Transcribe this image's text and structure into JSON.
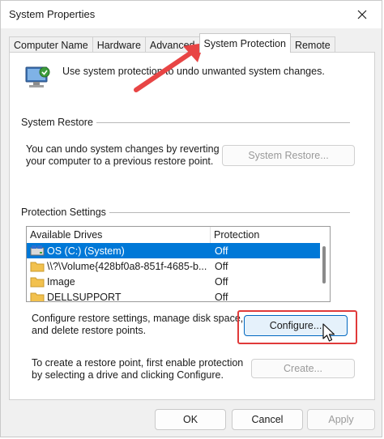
{
  "window": {
    "title": "System Properties"
  },
  "tabs": [
    {
      "label": "Computer Name",
      "active": false
    },
    {
      "label": "Hardware",
      "active": false
    },
    {
      "label": "Advanced",
      "active": false
    },
    {
      "label": "System Protection",
      "active": true
    },
    {
      "label": "Remote",
      "active": false
    }
  ],
  "intro": {
    "text": "Use system protection to undo unwanted system changes."
  },
  "system_restore": {
    "group_label": "System Restore",
    "description": "You can undo system changes by reverting your computer to a previous restore point.",
    "button_label": "System Restore..."
  },
  "protection": {
    "group_label": "Protection Settings",
    "columns": [
      "Available Drives",
      "Protection"
    ],
    "drives": [
      {
        "name": "OS (C:) (System)",
        "protection": "Off",
        "icon": "system-drive-icon",
        "selected": true
      },
      {
        "name": "\\\\?\\Volume{428bf0a8-851f-4685-b...",
        "protection": "Off",
        "icon": "folder-icon",
        "selected": false
      },
      {
        "name": "Image",
        "protection": "Off",
        "icon": "folder-icon",
        "selected": false
      },
      {
        "name": "DELLSUPPORT",
        "protection": "Off",
        "icon": "folder-icon",
        "selected": false
      }
    ],
    "configure_text": "Configure restore settings, manage disk space, and delete restore points.",
    "configure_label": "Configure...",
    "create_text": "To create a restore point, first enable protection by selecting a drive and clicking Configure.",
    "create_label": "Create..."
  },
  "footer": {
    "ok_label": "OK",
    "cancel_label": "Cancel",
    "apply_label": "Apply"
  },
  "colors": {
    "selection": "#0078d7",
    "annotation": "#e03a3a",
    "primary_border": "#0067c0"
  }
}
